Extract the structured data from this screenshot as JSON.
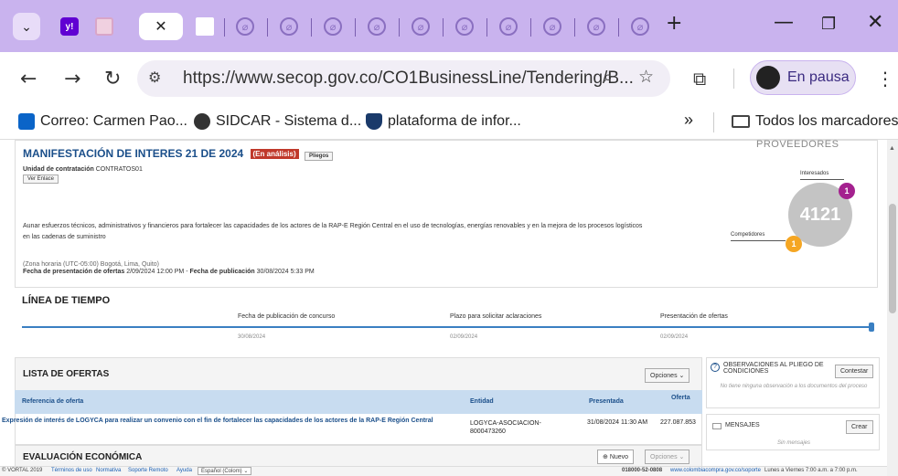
{
  "browser": {
    "url": "https://www.secop.gov.co/CO1BusinessLine/Tendering/B...",
    "profile_label": "En pausa",
    "bookmarks": [
      {
        "label": "Correo: Carmen Pao...",
        "icon": "outlook-icon"
      },
      {
        "label": "SIDCAR - Sistema d...",
        "icon": "globe-icon"
      },
      {
        "label": "plataforma de infor...",
        "icon": "shield-icon"
      }
    ],
    "more_bookmarks": "»",
    "all_bookmarks": "Todos los marcadores"
  },
  "process": {
    "title": "MANIFESTACIÓN DE INTERES 21 DE 2024",
    "status_badge": "(En análisis)",
    "pliegos_btn": "Pliegos",
    "unit_label": "Unidad de contratación",
    "unit_value": "CONTRATOS01",
    "ver_enlace": "Ver Enlace",
    "description": "Aunar esfuerzos técnicos, administrativos y financieros para fortalecer las capacidades de los actores de la RAP-E Región Central en el uso de tecnologías, energías renovables y en la mejora de los procesos logísticos en las cadenas de suministro",
    "timezone": "(Zona horaria (UTC-05:00) Bogotá, Lima, Quito)",
    "dates_label": "Fecha de presentación de ofertas",
    "dates_value": "2/09/2024 12:00 PM",
    "pub_label": "Fecha de publicación",
    "pub_value": "30/08/2024 5:33 PM"
  },
  "providers": {
    "header": "PROVEEDORES",
    "interesados_label": "Interesados",
    "interesados_count": "1",
    "competidores_label": "Competidores",
    "competidores_count": "1",
    "total": "4121"
  },
  "timeline": {
    "title": "LÍNEA DE TIEMPO",
    "events": [
      {
        "label": "Fecha de publicación de concurso",
        "date": "30/08/2024"
      },
      {
        "label": "Plazo para solicitar aclaraciones",
        "date": "02/09/2024"
      },
      {
        "label": "Presentación de ofertas",
        "date": "02/09/2024"
      }
    ]
  },
  "offers": {
    "title": "LISTA DE OFERTAS",
    "options_btn": "Opciones",
    "columns": [
      "Referencia de oferta",
      "Entidad",
      "Presentada",
      "Oferta"
    ],
    "rows": [
      {
        "reference": "Expresión de interés de LOGYCA para realizar un convenio con el fin de fortalecer las capacidades de los actores de la RAP-E Región Central",
        "entity": "LOGYCA-ASOCIACION-8000473260",
        "presented": "31/08/2024 11:30 AM",
        "offer": "227.087.853"
      }
    ]
  },
  "observations": {
    "title": "OBSERVACIONES AL PLIEGO DE CONDICIONES",
    "button": "Contestar",
    "empty_text": "No tiene ninguna observación a los documentos del proceso"
  },
  "messages": {
    "title": "MENSAJES",
    "button": "Crear",
    "empty_text": "Sin mensajes"
  },
  "evaluation": {
    "title": "EVALUACIÓN ECONÓMICA",
    "new_btn": "Nuevo",
    "options_btn": "Opciones"
  },
  "footer": {
    "copyright": "© VORTAL 2019",
    "links": [
      "Términos de uso",
      "Normativa",
      "Soporte Remoto",
      "Ayuda"
    ],
    "language": "Español (Colom)",
    "phone": "018000-52-0808",
    "support_url": "www.colombiacompra.gov.co/soporte",
    "hours": "Lunes a Viernes 7:00 a.m. a 7:00 p.m."
  },
  "colors": {
    "tabbar": "#c9b3ee",
    "link_blue": "#1b4f8a",
    "interesados": "#a4218f",
    "competidores": "#f5a623"
  }
}
